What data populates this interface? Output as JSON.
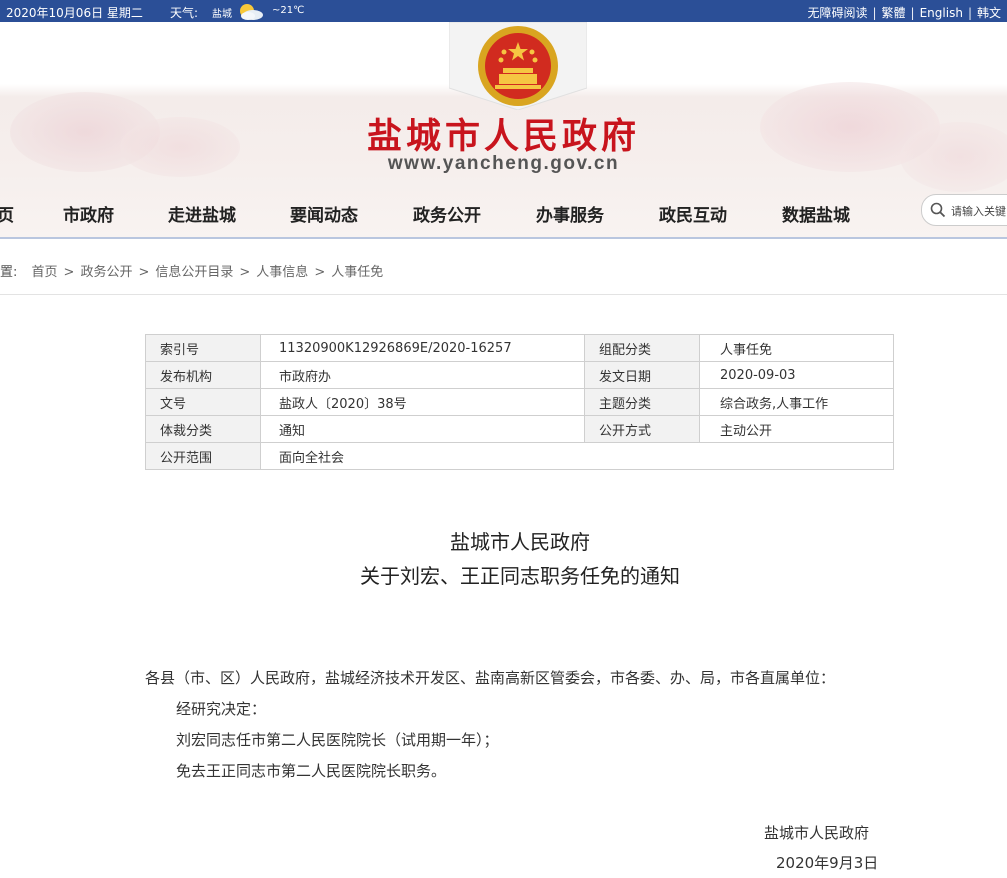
{
  "topbar": {
    "date": "2020年10月06日 星期二",
    "weather_label": "天气:",
    "weather_city": "盐城",
    "weather_temp": "~21℃",
    "weather_icon": "sun-cloud-icon",
    "links": [
      "无障碍阅读",
      "繁體",
      "English",
      "韩文"
    ]
  },
  "header": {
    "emblem": "national-emblem-icon",
    "site_name": "盐城市人民政府",
    "site_url": "www.yancheng.gov.cn"
  },
  "nav": {
    "items": [
      "页",
      "市政府",
      "走进盐城",
      "要闻动态",
      "政务公开",
      "办事服务",
      "政民互动",
      "数据盐城"
    ],
    "search_placeholder": "请输入关键"
  },
  "breadcrumb": {
    "prefix": "置:",
    "items": [
      "首页",
      "政务公开",
      "信息公开目录",
      "人事信息",
      "人事任免"
    ]
  },
  "meta": {
    "rows": [
      {
        "l1": "索引号",
        "v1": "11320900K12926869E/2020-16257",
        "l2": "组配分类",
        "v2": "人事任免"
      },
      {
        "l1": "发布机构",
        "v1": "市政府办",
        "l2": "发文日期",
        "v2": "2020-09-03"
      },
      {
        "l1": "文号",
        "v1": "盐政人〔2020〕38号",
        "l2": "主题分类",
        "v2": "综合政务,人事工作"
      },
      {
        "l1": "体裁分类",
        "v1": "通知",
        "l2": "公开方式",
        "v2": "主动公开"
      },
      {
        "l1": "公开范围",
        "v1": "面向全社会"
      }
    ]
  },
  "article": {
    "title_line1": "盐城市人民政府",
    "title_line2": "关于刘宏、王正同志职务任免的通知",
    "salutation": "各县（市、区）人民政府，盐城经济技术开发区、盐南高新区管委会，市各委、办、局，市各直属单位：",
    "p1": "经研究决定：",
    "p2": "刘宏同志任市第二人民医院院长（试用期一年）；",
    "p3": "免去王正同志市第二人民医院院长职务。",
    "signature": "盐城市人民政府",
    "date": "2020年9月3日"
  },
  "colors": {
    "topbar_bg": "#2b4f97",
    "site_name_red": "#c8141d"
  }
}
